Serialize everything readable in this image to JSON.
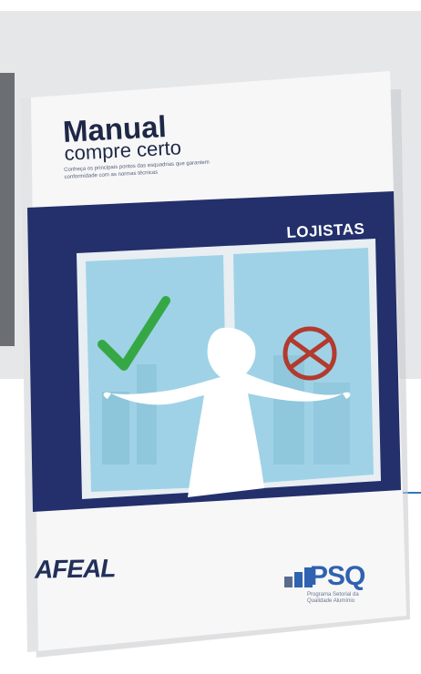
{
  "cover": {
    "title": "Manual",
    "subtitle": "compre certo",
    "description": "Conheça os principais pontos das esquadrias que garantem conformidade com as normas técnicas",
    "section": "LOJISTAS"
  },
  "logos": {
    "left": "AFEAL",
    "right": "PSQ",
    "right_caption": "Programa Setorial da Qualidade Alumínio"
  },
  "icons": [
    "check-icon",
    "forbidden-icon",
    "shrug-silhouette-icon"
  ],
  "colors": {
    "navy": "#24306b",
    "window_sky": "#9fd2e6",
    "check_green": "#35a845",
    "cross_red": "#b23a2e",
    "accent_blue": "#2b7bbf"
  }
}
